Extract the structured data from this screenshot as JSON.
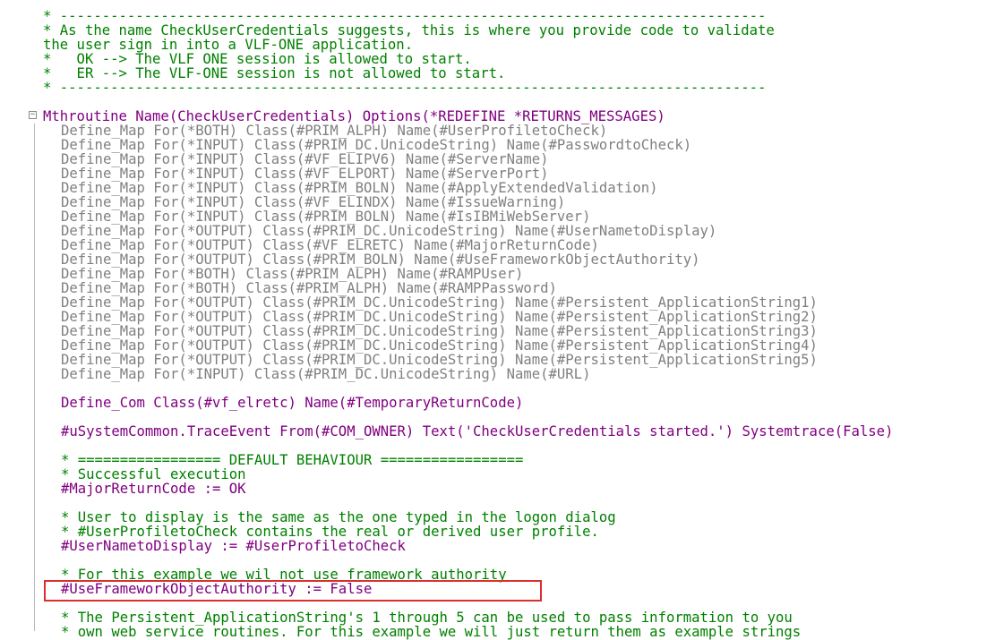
{
  "editor": {
    "fold_glyph": "−",
    "lines": [
      {
        "text": "* ------------------------------------------------------------------------------------",
        "style": "comment"
      },
      {
        "text": "* As the name CheckUserCredentials suggests, this is where you provide code to validate",
        "style": "comment"
      },
      {
        "text": "the user sign in into a VLF-ONE application.",
        "style": "comment"
      },
      {
        "text": "*   OK --> The VLF ONE session is allowed to start.",
        "style": "comment"
      },
      {
        "text": "*   ER --> The VLF-ONE session is not allowed to start.",
        "style": "comment"
      },
      {
        "text": "* ------------------------------------------------------------------------------------",
        "style": "comment"
      },
      {
        "text": "Mthroutine Name(CheckUserCredentials) Options(*REDEFINE *RETURNS_MESSAGES)",
        "style": "kw"
      },
      {
        "text": "Define_Map For(*BOTH) Class(#PRIM_ALPH) Name(#UserProfiletoCheck)",
        "style": "muted"
      },
      {
        "text": "Define_Map For(*INPUT) Class(#PRIM_DC.UnicodeString) Name(#PasswordtoCheck)",
        "style": "muted"
      },
      {
        "text": "Define_Map For(*INPUT) Class(#VF_ELIPV6) Name(#ServerName)",
        "style": "muted"
      },
      {
        "text": "Define_Map For(*INPUT) Class(#VF_ELPORT) Name(#ServerPort)",
        "style": "muted"
      },
      {
        "text": "Define_Map For(*INPUT) Class(#PRIM_BOLN) Name(#ApplyExtendedValidation)",
        "style": "muted"
      },
      {
        "text": "Define_Map For(*INPUT) Class(#VF_ELINDX) Name(#IssueWarning)",
        "style": "muted"
      },
      {
        "text": "Define_Map For(*INPUT) Class(#PRIM_BOLN) Name(#IsIBMiWebServer)",
        "style": "muted"
      },
      {
        "text": "Define_Map For(*OUTPUT) Class(#PRIM_DC.UnicodeString) Name(#UserNametoDisplay)",
        "style": "muted"
      },
      {
        "text": "Define_Map For(*OUTPUT) Class(#VF_ELRETC) Name(#MajorReturnCode)",
        "style": "muted"
      },
      {
        "text": "Define_Map For(*OUTPUT) Class(#PRIM_BOLN) Name(#UseFrameworkObjectAuthority)",
        "style": "muted"
      },
      {
        "text": "Define_Map For(*BOTH) Class(#PRIM_ALPH) Name(#RAMPUser)",
        "style": "muted"
      },
      {
        "text": "Define_Map For(*BOTH) Class(#PRIM_ALPH) Name(#RAMPPassword)",
        "style": "muted"
      },
      {
        "text": "Define_Map For(*OUTPUT) Class(#PRIM_DC.UnicodeString) Name(#Persistent_ApplicationString1)",
        "style": "muted"
      },
      {
        "text": "Define_Map For(*OUTPUT) Class(#PRIM_DC.UnicodeString) Name(#Persistent_ApplicationString2)",
        "style": "muted"
      },
      {
        "text": "Define_Map For(*OUTPUT) Class(#PRIM_DC.UnicodeString) Name(#Persistent_ApplicationString3)",
        "style": "muted"
      },
      {
        "text": "Define_Map For(*OUTPUT) Class(#PRIM_DC.UnicodeString) Name(#Persistent_ApplicationString4)",
        "style": "muted"
      },
      {
        "text": "Define_Map For(*OUTPUT) Class(#PRIM_DC.UnicodeString) Name(#Persistent_ApplicationString5)",
        "style": "muted"
      },
      {
        "text": "Define_Map For(*INPUT) Class(#PRIM_DC.UnicodeString) Name(#URL)",
        "style": "muted"
      },
      {
        "text": "Define_Com Class(#vf_elretc) Name(#TemporaryReturnCode)",
        "style": "kw"
      },
      {
        "text": "#uSystemCommon.TraceEvent From(#COM_OWNER) Text('CheckUserCredentials started.') Systemtrace(False)",
        "style": "kw"
      },
      {
        "text": "* ================= DEFAULT BEHAVIOUR =================",
        "style": "comment"
      },
      {
        "text": "* Successful execution",
        "style": "comment"
      },
      {
        "text": "#MajorReturnCode := OK",
        "style": "kw"
      },
      {
        "text": "* User to display is the same as the one typed in the logon dialog",
        "style": "comment"
      },
      {
        "text": "* #UserProfiletoCheck contains the real or derived user profile.",
        "style": "comment"
      },
      {
        "text": "#UserNametoDisplay := #UserProfiletoCheck",
        "style": "kw"
      },
      {
        "text": "* For this example we wil not use framework authority",
        "style": "comment"
      },
      {
        "text": "#UseFrameworkObjectAuthority := False",
        "style": "kw"
      },
      {
        "text": "* The Persistent_ApplicationString's 1 through 5 can be used to pass information to you",
        "style": "comment"
      },
      {
        "text": "* own web service routines. For this example we will just return them as example strings",
        "style": "comment"
      }
    ]
  }
}
